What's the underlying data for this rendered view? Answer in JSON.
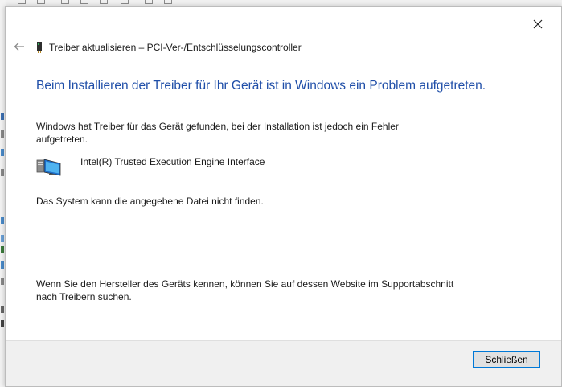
{
  "dialog": {
    "title": "Treiber aktualisieren – PCI-Ver-/Entschlüsselungscontroller",
    "heading": "Beim Installieren der Treiber für Ihr Gerät ist in Windows ein Problem aufgetreten.",
    "message": "Windows hat Treiber für das Gerät gefunden, bei der Installation ist jedoch ein Fehler aufgetreten.",
    "device_name": "Intel(R) Trusted Execution Engine Interface",
    "error_text": "Das System kann die angegebene Datei nicht finden.",
    "hint_text": "Wenn Sie den Hersteller des Geräts kennen, können Sie auf dessen Website im Supportabschnitt nach Treibern suchen.",
    "close_button_label": "Schließen"
  },
  "icons": {
    "close": "close-icon",
    "back": "back-arrow-icon",
    "title": "pci-card-icon",
    "device": "computer-monitor-icon"
  },
  "colors": {
    "heading": "#1f4ea8",
    "button_focus_border": "#0078d7",
    "footer_bg": "#f0f0f0"
  }
}
